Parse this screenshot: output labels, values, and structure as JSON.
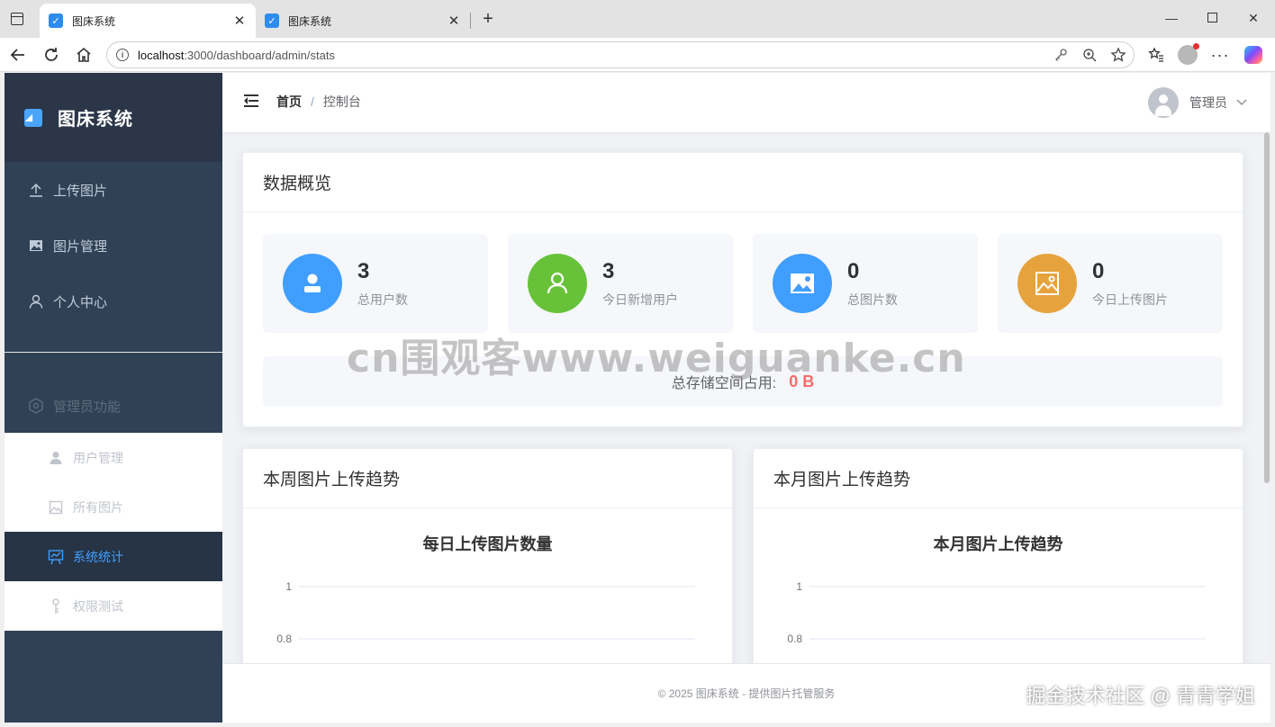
{
  "browser": {
    "tabs": [
      {
        "title": "图床系统",
        "active": true
      },
      {
        "title": "图床系统",
        "active": false
      }
    ],
    "url_host": "localhost",
    "url_path": ":3000/dashboard/admin/stats"
  },
  "sidebar": {
    "logo": "图床系统",
    "items": [
      {
        "label": "上传图片",
        "icon": "upload-icon"
      },
      {
        "label": "图片管理",
        "icon": "image-icon"
      },
      {
        "label": "个人中心",
        "icon": "user-icon"
      }
    ],
    "admin_group": {
      "label": "管理员功能",
      "icon": "gear-icon"
    },
    "admin_items": [
      {
        "label": "用户管理",
        "icon": "user-filled-icon",
        "active": false
      },
      {
        "label": "所有图片",
        "icon": "picture-icon",
        "active": false
      },
      {
        "label": "系统统计",
        "icon": "stats-icon",
        "active": true
      },
      {
        "label": "权限测试",
        "icon": "key-icon",
        "active": false
      }
    ]
  },
  "header": {
    "breadcrumb_home": "首页",
    "breadcrumb_sep": "/",
    "breadcrumb_current": "控制台",
    "username": "管理员"
  },
  "overview": {
    "title": "数据概览",
    "stats": [
      {
        "value": "3",
        "label": "总用户数",
        "color": "#409eff",
        "icon": "user-filled-icon"
      },
      {
        "value": "3",
        "label": "今日新增用户",
        "color": "#67c23a",
        "icon": "user-icon"
      },
      {
        "value": "0",
        "label": "总图片数",
        "color": "#409eff",
        "icon": "picture-filled-icon"
      },
      {
        "value": "0",
        "label": "今日上传图片",
        "color": "#e6a23c",
        "icon": "picture-icon"
      }
    ],
    "storage_label": "总存储空间占用:",
    "storage_value": "0 B"
  },
  "charts": {
    "weekly_card_title": "本周图片上传趋势",
    "monthly_card_title": "本月图片上传趋势"
  },
  "chart_data": [
    {
      "type": "line",
      "title": "每日上传图片数量",
      "ylabel": "",
      "xlabel": "",
      "y_ticks": [
        "1",
        "0.8"
      ],
      "ylim": [
        0,
        1
      ],
      "grid": true
    },
    {
      "type": "line",
      "title": "本月图片上传趋势",
      "ylabel": "",
      "xlabel": "",
      "y_ticks": [
        "1",
        "0.8"
      ],
      "ylim": [
        0,
        1
      ],
      "grid": true
    }
  ],
  "footer": {
    "text": "© 2025 图床系统 - 提供图片托管服务"
  },
  "overlay": {
    "watermark": "cn围观客www.weiguanke.cn",
    "credit": "掘金技术社区 @ 青青学姐"
  }
}
